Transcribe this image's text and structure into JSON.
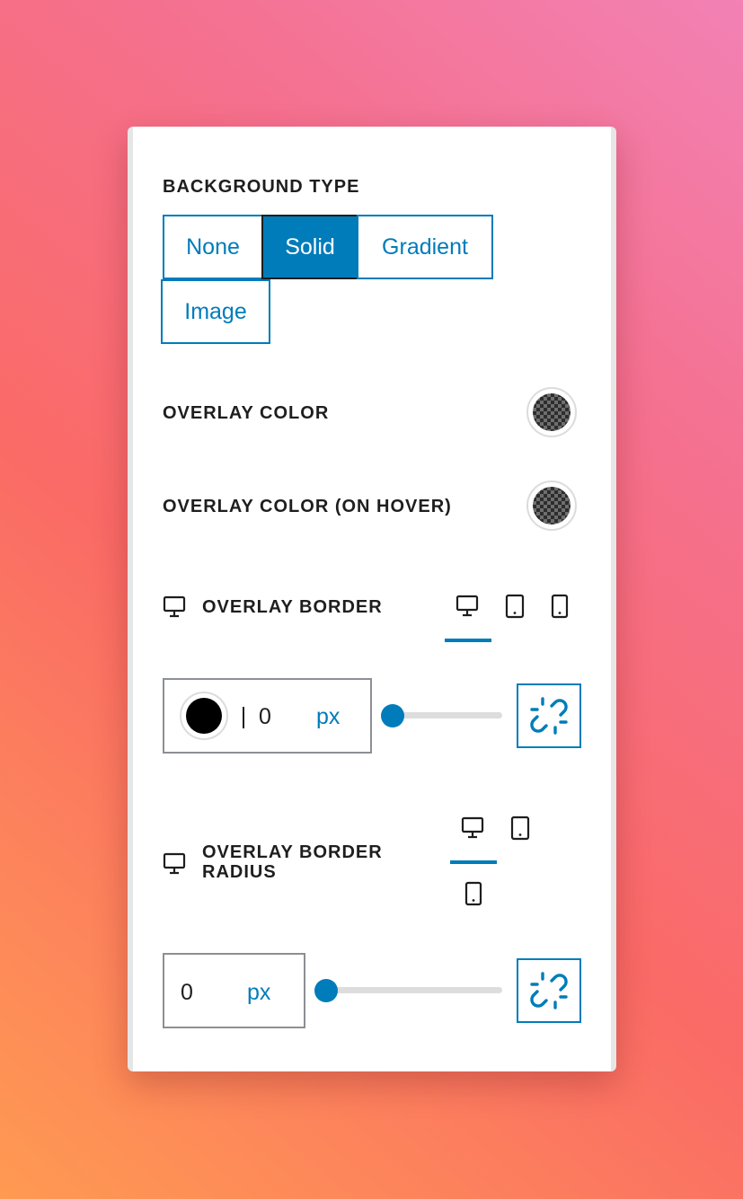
{
  "background_type": {
    "label": "BACKGROUND TYPE",
    "options": [
      "None",
      "Solid",
      "Gradient",
      "Image"
    ],
    "selected": "Solid"
  },
  "overlay_color": {
    "label": "OVERLAY COLOR"
  },
  "overlay_color_hover": {
    "label": "OVERLAY COLOR (ON HOVER)"
  },
  "overlay_border": {
    "label": "OVERLAY BORDER",
    "active_device": "desktop",
    "devices": [
      "desktop-icon",
      "tablet-icon",
      "mobile-icon"
    ],
    "color": "#000000",
    "value": "0",
    "unit": "px",
    "slider_fraction": 0
  },
  "overlay_border_radius": {
    "label": "OVERLAY BORDER RADIUS",
    "active_device": "desktop",
    "devices": [
      "desktop-icon",
      "tablet-icon",
      "mobile-icon"
    ],
    "value": "0",
    "unit": "px",
    "slider_fraction": 0
  },
  "colors": {
    "accent": "#007cba",
    "text": "#1e1e1e"
  }
}
